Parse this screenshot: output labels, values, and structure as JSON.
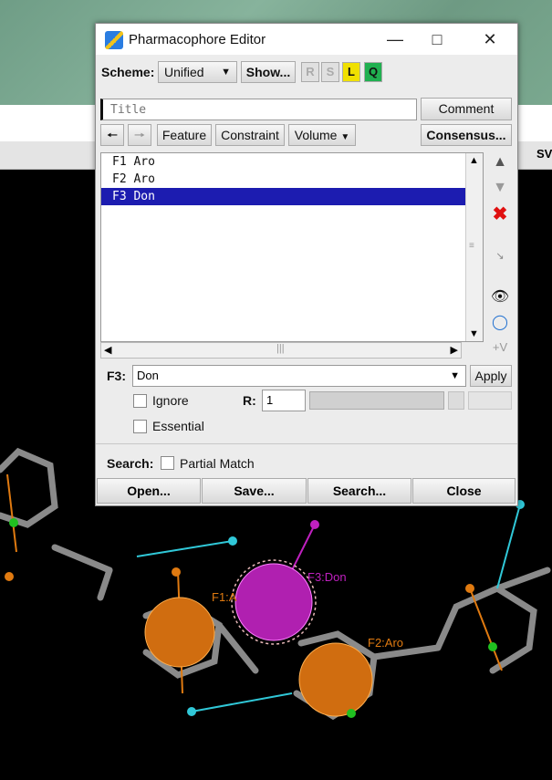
{
  "window": {
    "title": "Pharmacophore Editor"
  },
  "background": {
    "toolbar_fragment": "SV"
  },
  "toolbar": {
    "scheme_label": "Scheme:",
    "scheme_value": "Unified",
    "show_label": "Show...",
    "r_label": "R",
    "s_label": "S",
    "l_label": "L",
    "q_label": "Q"
  },
  "title_field": {
    "placeholder": "Title"
  },
  "comment_label": "Comment",
  "feature_bar": {
    "feature_label": "Feature",
    "constraint_label": "Constraint",
    "volume_label": "Volume",
    "consensus_label": "Consensus..."
  },
  "features": [
    {
      "label": "F1 Aro",
      "selected": false
    },
    {
      "label": "F2 Aro",
      "selected": false
    },
    {
      "label": "F3 Don",
      "selected": true
    }
  ],
  "editor": {
    "feature_id": "F3:",
    "type_value": "Don",
    "apply_label": "Apply",
    "ignore_label": "Ignore",
    "r_label": "R:",
    "r_value": "1",
    "essential_label": "Essential"
  },
  "search": {
    "label": "Search:",
    "partial_match_label": "Partial Match"
  },
  "footer": {
    "open_label": "Open...",
    "save_label": "Save...",
    "search_label": "Search...",
    "close_label": "Close"
  },
  "scene_labels": {
    "f1": "F1:A",
    "f2": "F2:Aro",
    "f3": "F3:Don"
  },
  "colors": {
    "selection": "#1c1cb0",
    "l_button": "#f0e000",
    "q_button": "#20b050",
    "donor": "#c020c0",
    "aromatic": "#e07a10",
    "acceptor": "#30c8d8"
  },
  "icons": [
    "move-up-icon",
    "move-down-icon",
    "delete-icon",
    "distance-icon",
    "hide-icon",
    "link-icon",
    "add-volume-icon",
    "back-arrow-icon",
    "forward-arrow-icon"
  ]
}
